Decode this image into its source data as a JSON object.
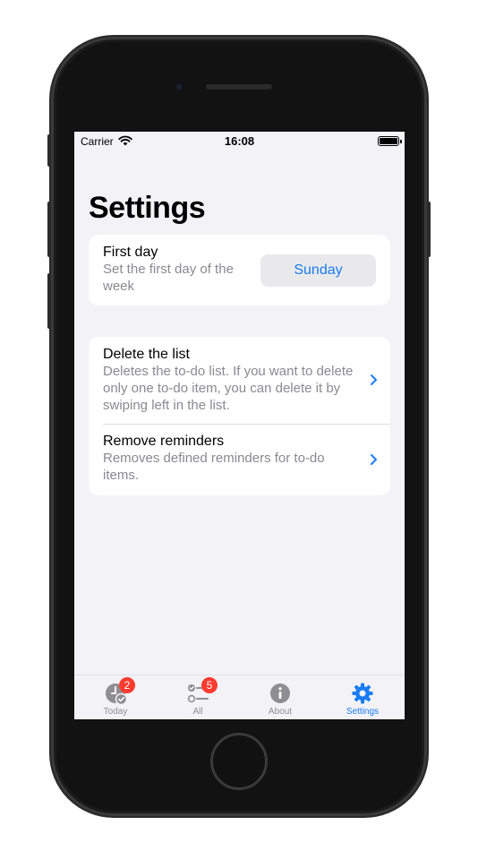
{
  "status_bar": {
    "carrier": "Carrier",
    "time": "16:08"
  },
  "page": {
    "title": "Settings"
  },
  "first_day": {
    "title": "First day",
    "subtitle": "Set the first day of the week",
    "value": "Sunday"
  },
  "actions": [
    {
      "title": "Delete the list",
      "subtitle": "Deletes the to-do list. If you want to delete only one to-do item, you can delete it by swiping left in the list."
    },
    {
      "title": "Remove reminders",
      "subtitle": "Removes defined reminders for to-do items."
    }
  ],
  "tabs": [
    {
      "label": "Today",
      "icon": "clock-check-icon",
      "badge": "2"
    },
    {
      "label": "All",
      "icon": "list-icon",
      "badge": "5"
    },
    {
      "label": "About",
      "icon": "info-icon",
      "badge": ""
    },
    {
      "label": "Settings",
      "icon": "gear-icon",
      "badge": ""
    }
  ],
  "colors": {
    "accent": "#1a7cf5",
    "badge": "#ff3b30",
    "background": "#f2f2f7",
    "tab_inactive": "#8e8e93"
  }
}
